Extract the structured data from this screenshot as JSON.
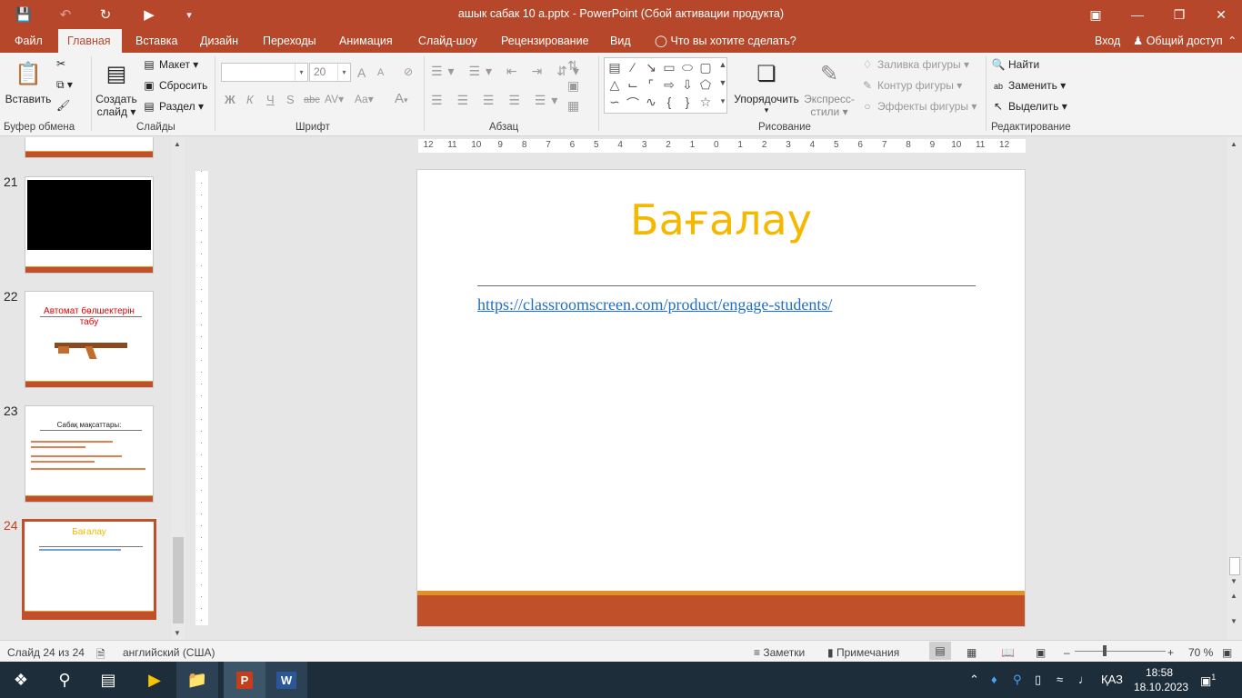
{
  "window": {
    "title": "ашык сабак 10 а.pptx - PowerPoint (Сбой активации продукта)"
  },
  "tabs": [
    {
      "label": "Файл"
    },
    {
      "label": "Главная"
    },
    {
      "label": "Вставка"
    },
    {
      "label": "Дизайн"
    },
    {
      "label": "Переходы"
    },
    {
      "label": "Анимация"
    },
    {
      "label": "Слайд-шоу"
    },
    {
      "label": "Рецензирование"
    },
    {
      "label": "Вид"
    }
  ],
  "tell_me": "Что вы хотите сделать?",
  "signin": "Вход",
  "share": "Общий доступ",
  "ribbon": {
    "clipboard": {
      "paste": "Вставить",
      "label": "Буфер обмена"
    },
    "slides": {
      "new_slide_1": "Создать",
      "new_slide_2": "слайд",
      "layout": "Макет",
      "reset": "Сбросить",
      "section": "Раздел",
      "label": "Слайды"
    },
    "font": {
      "size": "20",
      "bold": "Ж",
      "italic": "К",
      "underline": "Ч",
      "shadow": "S",
      "strike": "abc",
      "spacing": "AV",
      "case": "Aa",
      "color": "A",
      "grow": "A",
      "shrink": "A",
      "label": "Шрифт"
    },
    "paragraph": {
      "label": "Абзац"
    },
    "drawing": {
      "arrange": "Упорядочить",
      "quick_styles_1": "Экспресс-",
      "quick_styles_2": "стили",
      "fill": "Заливка фигуры",
      "outline": "Контур фигуры",
      "effects": "Эффекты фигуры",
      "label": "Рисование"
    },
    "editing": {
      "find": "Найти",
      "replace": "Заменить",
      "select": "Выделить",
      "label": "Редактирование"
    }
  },
  "thumbnails": [
    {
      "number": "21"
    },
    {
      "number": "22",
      "title": "Автомат бөлшектерін табу"
    },
    {
      "number": "23",
      "title": "Сабақ мақсаттары:"
    },
    {
      "number": "24",
      "title": "Бағалау"
    }
  ],
  "slide": {
    "title": "Бағалау",
    "link": "https://classroomscreen.com/product/engage-students/"
  },
  "ruler_labels": [
    "12",
    "11",
    "10",
    "9",
    "8",
    "7",
    "6",
    "5",
    "4",
    "3",
    "2",
    "1",
    "0",
    "1",
    "2",
    "3",
    "4",
    "5",
    "6",
    "7",
    "8",
    "9",
    "10",
    "11",
    "12"
  ],
  "status": {
    "slide_count": "Слайд 24 из 24",
    "language": "английский (США)",
    "notes": "Заметки",
    "comments": "Примечания",
    "zoom": "70 %"
  },
  "taskbar": {
    "lang": "ҚАЗ",
    "time": "18:58",
    "date": "18.10.2023",
    "notif_count": "1"
  },
  "colors": {
    "accent": "#b7472a",
    "title_yellow": "#f5b800",
    "footer_orange": "#c0502a"
  }
}
